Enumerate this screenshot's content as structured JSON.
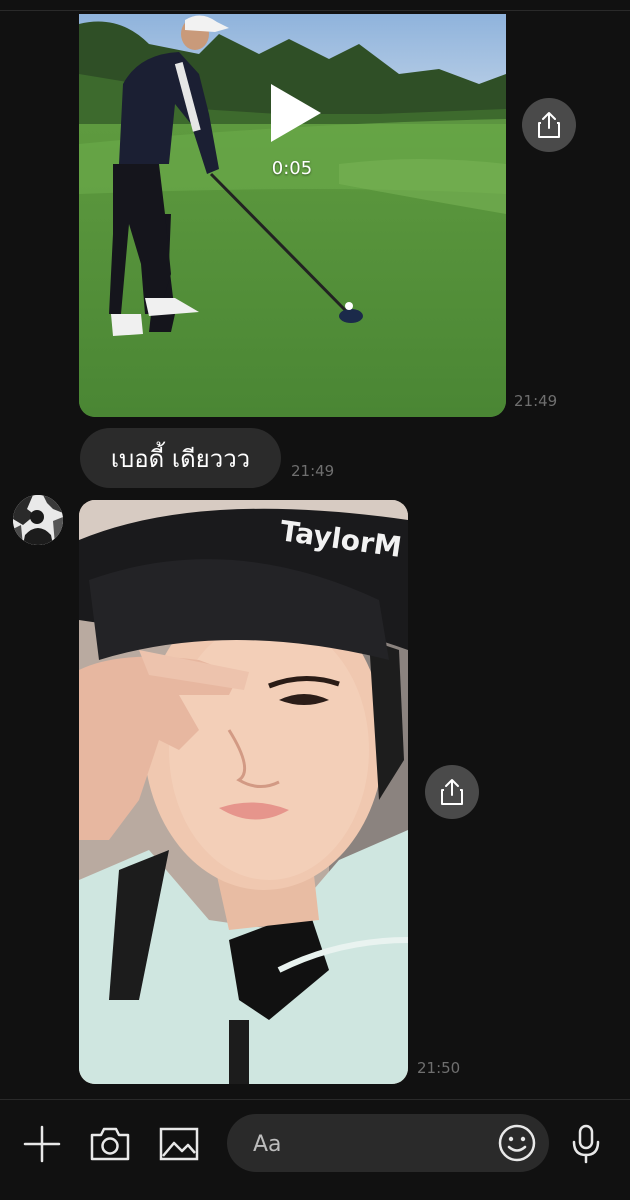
{
  "chat": {
    "messages": [
      {
        "type": "video",
        "duration": "0:05",
        "time": "21:49"
      },
      {
        "type": "text",
        "text": "เบอดี้ เดียววว",
        "time": "21:49"
      },
      {
        "type": "photo",
        "time": "21:50"
      }
    ]
  },
  "input_bar": {
    "placeholder": "Aa"
  },
  "icons": {
    "share": "share-icon",
    "play": "play-icon",
    "plus": "plus-icon",
    "camera": "camera-icon",
    "image": "image-icon",
    "emoji": "emoji-icon",
    "mic": "microphone-icon"
  },
  "colors": {
    "background": "#111111",
    "bubble": "#2b2b2b",
    "share_button": "#4a4a4a",
    "timestamp": "#6f6f6f",
    "input_field": "#2a2a2a"
  }
}
